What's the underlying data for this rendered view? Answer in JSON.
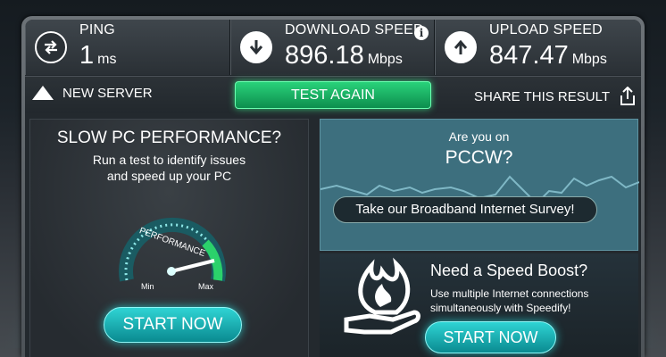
{
  "stats": {
    "ping": {
      "label": "PING",
      "value": "1",
      "unit": "ms"
    },
    "download": {
      "label": "DOWNLOAD SPEED",
      "value": "896.18",
      "unit": "Mbps"
    },
    "upload": {
      "label": "UPLOAD SPEED",
      "value": "847.47",
      "unit": "Mbps"
    }
  },
  "actions": {
    "new_server": "NEW SERVER",
    "test_again": "TEST AGAIN",
    "share": "SHARE THIS RESULT"
  },
  "ad_pc": {
    "title": "SLOW PC PERFORMANCE?",
    "subtitle_line1": "Run a test to identify issues",
    "subtitle_line2": "and speed up your PC",
    "gauge_label": "PERFORMANCE",
    "gauge_min": "Min",
    "gauge_max": "Max",
    "button": "START NOW"
  },
  "survey": {
    "line1": "Are you on",
    "line2": "PCCW?",
    "button": "Take our Broadband Internet Survey!"
  },
  "boost": {
    "title": "Need a Speed Boost?",
    "sub_line1": "Use multiple Internet connections",
    "sub_line2": "simultaneously with Speedify!",
    "button": "START NOW"
  },
  "colors": {
    "accent_green": "#22c873",
    "accent_teal": "#1cb8bd",
    "survey_bg": "#3d6f7e"
  }
}
